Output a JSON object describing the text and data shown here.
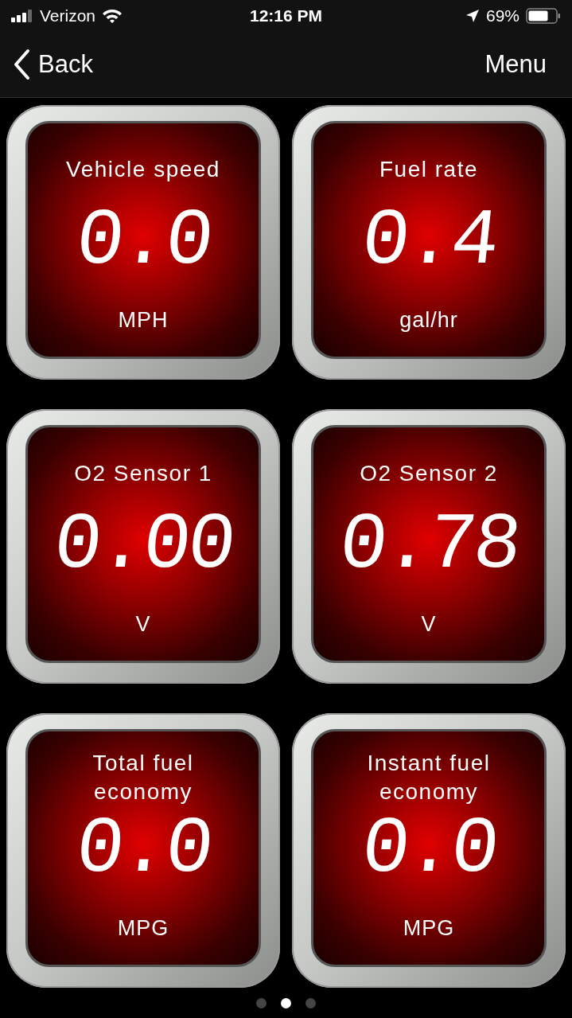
{
  "status_bar": {
    "carrier": "Verizon",
    "time": "12:16 PM",
    "battery": "69%"
  },
  "nav": {
    "back": "Back",
    "menu": "Menu"
  },
  "gauges": [
    {
      "title": "Vehicle speed",
      "value": "0.0",
      "unit": "MPH"
    },
    {
      "title": "Fuel rate",
      "value": "0.4",
      "unit": "gal/hr"
    },
    {
      "title": "O2 Sensor 1",
      "value": "0.00",
      "unit": "V"
    },
    {
      "title": "O2 Sensor 2",
      "value": "0.78",
      "unit": "V"
    },
    {
      "title": "Total fuel economy",
      "value": "0.0",
      "unit": "MPG"
    },
    {
      "title": "Instant fuel economy",
      "value": "0.0",
      "unit": "MPG"
    }
  ],
  "pages": [
    {
      "selected": false
    },
    {
      "selected": true
    },
    {
      "selected": false
    }
  ]
}
